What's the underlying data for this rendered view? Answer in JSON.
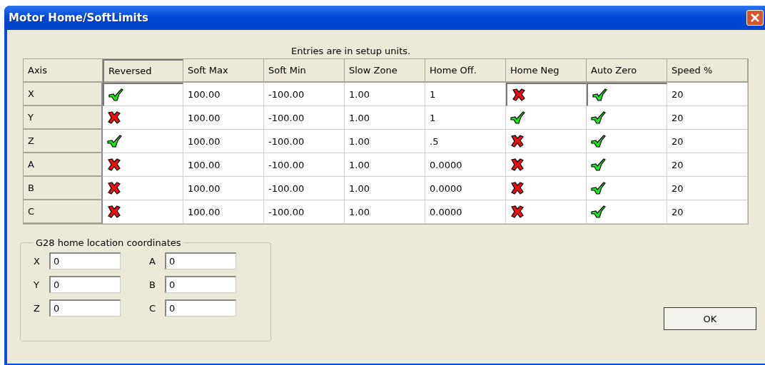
{
  "window": {
    "title": "Motor Home/SoftLimits"
  },
  "note": "Entries are in setup units.",
  "table": {
    "columns": [
      "Axis",
      "Reversed",
      "Soft Max",
      "Soft Min",
      "Slow Zone",
      "Home Off.",
      "Home Neg",
      "Auto Zero",
      "Speed %"
    ],
    "rows": [
      {
        "axis": "X",
        "reversed": true,
        "soft_max": "100.00",
        "soft_min": "-100.00",
        "slow_zone": "1.00",
        "home_off": "1",
        "home_neg": false,
        "auto_zero": true,
        "speed": "20"
      },
      {
        "axis": "Y",
        "reversed": false,
        "soft_max": "100.00",
        "soft_min": "-100.00",
        "slow_zone": "1.00",
        "home_off": "1",
        "home_neg": true,
        "auto_zero": true,
        "speed": "20"
      },
      {
        "axis": "Z",
        "reversed": true,
        "soft_max": "100.00",
        "soft_min": "-100.00",
        "slow_zone": "1.00",
        "home_off": ".5",
        "home_neg": false,
        "auto_zero": true,
        "speed": "20"
      },
      {
        "axis": "A",
        "reversed": false,
        "soft_max": "100.00",
        "soft_min": "-100.00",
        "slow_zone": "1.00",
        "home_off": "0.0000",
        "home_neg": false,
        "auto_zero": true,
        "speed": "20"
      },
      {
        "axis": "B",
        "reversed": false,
        "soft_max": "100.00",
        "soft_min": "-100.00",
        "slow_zone": "1.00",
        "home_off": "0.0000",
        "home_neg": false,
        "auto_zero": true,
        "speed": "20"
      },
      {
        "axis": "C",
        "reversed": false,
        "soft_max": "100.00",
        "soft_min": "-100.00",
        "slow_zone": "1.00",
        "home_off": "0.0000",
        "home_neg": false,
        "auto_zero": true,
        "speed": "20"
      }
    ]
  },
  "g28": {
    "title": "G28 home location coordinates",
    "fields": [
      {
        "label": "X",
        "value": "0"
      },
      {
        "label": "A",
        "value": "0"
      },
      {
        "label": "Y",
        "value": "0"
      },
      {
        "label": "B",
        "value": "0"
      },
      {
        "label": "Z",
        "value": "0"
      },
      {
        "label": "C",
        "value": "0"
      }
    ]
  },
  "buttons": [
    "OK"
  ]
}
